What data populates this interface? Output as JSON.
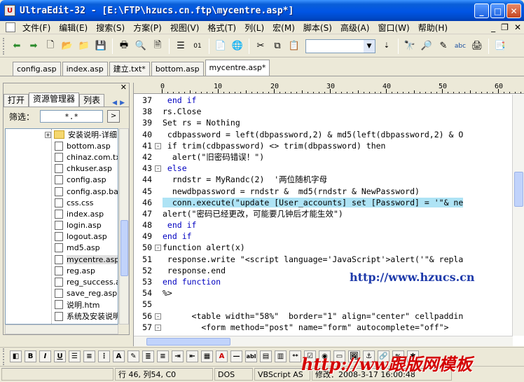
{
  "window": {
    "title": "UltraEdit-32 - [E:\\FTP\\hzucs.cn.ftp\\mycentre.asp*]",
    "app_icon_letter": "U"
  },
  "menu": {
    "items": [
      "文件(F)",
      "编辑(E)",
      "搜索(S)",
      "方案(P)",
      "视图(V)",
      "格式(T)",
      "列(L)",
      "宏(M)",
      "脚本(S)",
      "高级(A)",
      "窗口(W)",
      "帮助(H)"
    ]
  },
  "file_tabs": [
    {
      "label": "config.asp",
      "active": false
    },
    {
      "label": "index.asp",
      "active": false
    },
    {
      "label": "建立.txt*",
      "active": false
    },
    {
      "label": "bottom.asp",
      "active": false
    },
    {
      "label": "mycentre.asp*",
      "active": true
    }
  ],
  "left_panel": {
    "tabs": [
      "打开",
      "资源管理器",
      "列表"
    ],
    "filter_label": "筛选：",
    "filter_value": "*.*",
    "folder": "安装说明-详细",
    "files": [
      "bottom.asp",
      "chinaz.com.txt",
      "chkuser.asp",
      "config.asp",
      "config.asp.bak",
      "css.css",
      "index.asp",
      "login.asp",
      "logout.asp",
      "md5.asp",
      "mycentre.asp",
      "reg.asp",
      "reg_success.asp",
      "save_reg.asp",
      "说明.htm",
      "系统及安装说明"
    ],
    "selected_file": "mycentre.asp"
  },
  "ruler": {
    "labels": [
      "0",
      "10",
      "20",
      "30",
      "40",
      "50",
      "60"
    ]
  },
  "code_lines": [
    {
      "n": "37",
      "fold": "",
      "text": " end if"
    },
    {
      "n": "38",
      "fold": "",
      "text": "rs.Close"
    },
    {
      "n": "39",
      "fold": "",
      "text": "Set rs = Nothing"
    },
    {
      "n": "40",
      "fold": "",
      "text": " cdbpassword = left(dbpassword,2) & md5(left(dbpassword,2) & O"
    },
    {
      "n": "41",
      "fold": "-",
      "text": " if trim(cdbpassword) <> trim(dbpassword) then"
    },
    {
      "n": "42",
      "fold": "",
      "text": "  alert(\"旧密码错误！\")"
    },
    {
      "n": "43",
      "fold": "-",
      "text": " else"
    },
    {
      "n": "44",
      "fold": "",
      "text": "  rndstr = MyRandc(2)  '两位随机字母"
    },
    {
      "n": "45",
      "fold": "",
      "text": "  newdbpassword = rndstr &  md5(rndstr & NewPassword)"
    },
    {
      "n": "46",
      "fold": "",
      "text": "  conn.execute(\"update [User_accounts] set [Password] = '\"& ne"
    },
    {
      "n": "47",
      "fold": "",
      "text": "alert(\"密码已经更改，可能要几钟后才能生效\")"
    },
    {
      "n": "48",
      "fold": "",
      "text": " end if"
    },
    {
      "n": "49",
      "fold": "",
      "text": "end if"
    },
    {
      "n": "50",
      "fold": "-",
      "text": "function alert(x)"
    },
    {
      "n": "51",
      "fold": "",
      "text": " response.write \"<script language='JavaScript'>alert('\"& repla"
    },
    {
      "n": "52",
      "fold": "",
      "text": " response.end"
    },
    {
      "n": "53",
      "fold": "",
      "text": "end function"
    },
    {
      "n": "54",
      "fold": "",
      "text": "%>"
    },
    {
      "n": "55",
      "fold": "",
      "text": ""
    },
    {
      "n": "56",
      "fold": "-",
      "text": "      <table width=\"58%\"  border=\"1\" align=\"center\" cellpaddin"
    },
    {
      "n": "57",
      "fold": "-",
      "text": "        <form method=\"post\" name=\"form\" autocomplete=\"off\">"
    }
  ],
  "highlighted_line": "46",
  "overlay_url": "http://www.hzucs.cn",
  "status": {
    "position": "行 46, 列54, C0",
    "line_ending": "DOS",
    "syntax": "VBScript AS",
    "modified": "修改：2008-3-17 16:00:48"
  },
  "watermark": "http://ww跟版网模板",
  "colors": {
    "keyword": "#0000c0",
    "function": "#e0502a",
    "string": "#808080",
    "highlight": "#aee3f5",
    "titlebar": "#0055e5"
  }
}
